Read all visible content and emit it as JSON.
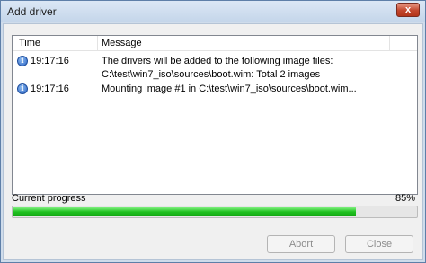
{
  "window": {
    "title": "Add driver",
    "close_glyph": "x"
  },
  "log": {
    "columns": {
      "time": "Time",
      "message": "Message"
    },
    "rows": [
      {
        "icon": "info-icon",
        "time": "19:17:16",
        "message": "The drivers will be added to the following image files:",
        "continuation": "C:\\test\\win7_iso\\sources\\boot.wim: Total 2 images"
      },
      {
        "icon": "info-icon",
        "time": "19:17:16",
        "message": "Mounting image #1 in C:\\test\\win7_iso\\sources\\boot.wim..."
      }
    ]
  },
  "progress": {
    "label": "Current progress",
    "percent_text": "85%",
    "value": 0.85
  },
  "buttons": {
    "abort": "Abort",
    "close": "Close"
  },
  "colors": {
    "progress_fill": "#1fc11f",
    "disabled_text": "#8c8c8c"
  }
}
